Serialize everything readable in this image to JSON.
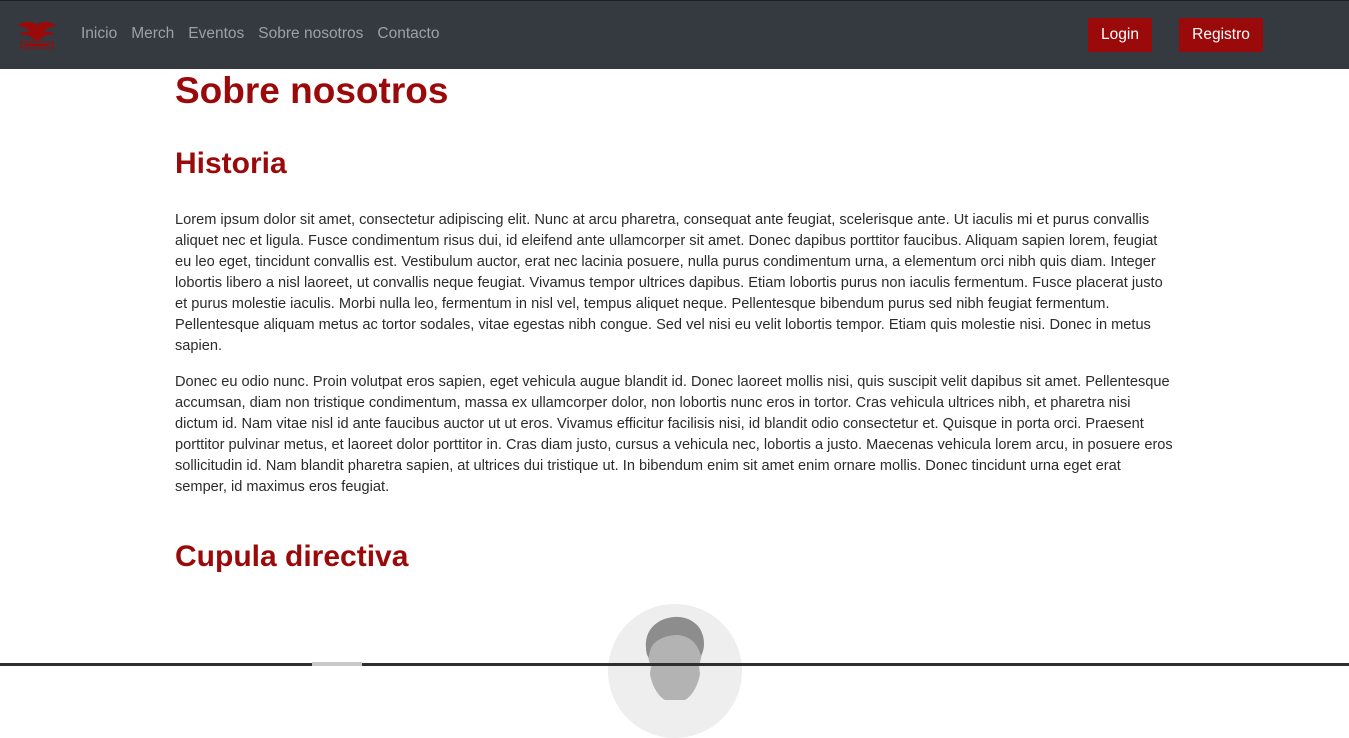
{
  "navbar": {
    "logo_icon": "eagle-logo-icon",
    "links": [
      "Inicio",
      "Merch",
      "Eventos",
      "Sobre nosotros",
      "Contacto"
    ],
    "login_label": "Login",
    "register_label": "Registro"
  },
  "main": {
    "title": "Sobre nosotros",
    "history_heading": "Historia",
    "history_paragraphs": [
      "Lorem ipsum dolor sit amet, consectetur adipiscing elit. Nunc at arcu pharetra, consequat ante feugiat, scelerisque ante. Ut iaculis mi et purus convallis aliquet nec et ligula. Fusce condimentum risus dui, id eleifend ante ullamcorper sit amet. Donec dapibus porttitor faucibus. Aliquam sapien lorem, feugiat eu leo eget, tincidunt convallis est. Vestibulum auctor, erat nec lacinia posuere, nulla purus condimentum urna, a elementum orci nibh quis diam. Integer lobortis libero a nisl laoreet, ut convallis neque feugiat. Vivamus tempor ultrices dapibus. Etiam lobortis purus non iaculis fermentum. Fusce placerat justo et purus molestie iaculis. Morbi nulla leo, fermentum in nisl vel, tempus aliquet neque. Pellentesque bibendum purus sed nibh feugiat fermentum. Pellentesque aliquam metus ac tortor sodales, vitae egestas nibh congue. Sed vel nisi eu velit lobortis tempor. Etiam quis molestie nisi. Donec in metus sapien.",
      "Donec eu odio nunc. Proin volutpat eros sapien, eget vehicula augue blandit id. Donec laoreet mollis nisi, quis suscipit velit dapibus sit amet. Pellentesque accumsan, diam non tristique condimentum, massa ex ullamcorper dolor, non lobortis nunc eros in tortor. Cras vehicula ultrices nibh, et pharetra nisi dictum id. Nam vitae nisl id ante faucibus auctor ut ut eros. Vivamus efficitur facilisis nisi, id blandit odio consectetur et. Quisque in porta orci. Praesent porttitor pulvinar metus, et laoreet dolor porttitor in. Cras diam justo, cursus a vehicula nec, lobortis a justo. Maecenas vehicula lorem arcu, in posuere eros sollicitudin id. Nam blandit pharetra sapien, at ultrices dui tristique ut. In bibendum enim sit amet enim ornare mollis. Donec tincidunt urna eget erat semper, id maximus eros feugiat."
    ],
    "board_heading": "Cupula directiva",
    "board_avatar_icon": "person-avatar-icon"
  },
  "colors": {
    "navbar_bg": "#343a40",
    "nav_link": "#9da1a5",
    "accent": "#9b0a0a",
    "text": "#2b2b2b"
  }
}
